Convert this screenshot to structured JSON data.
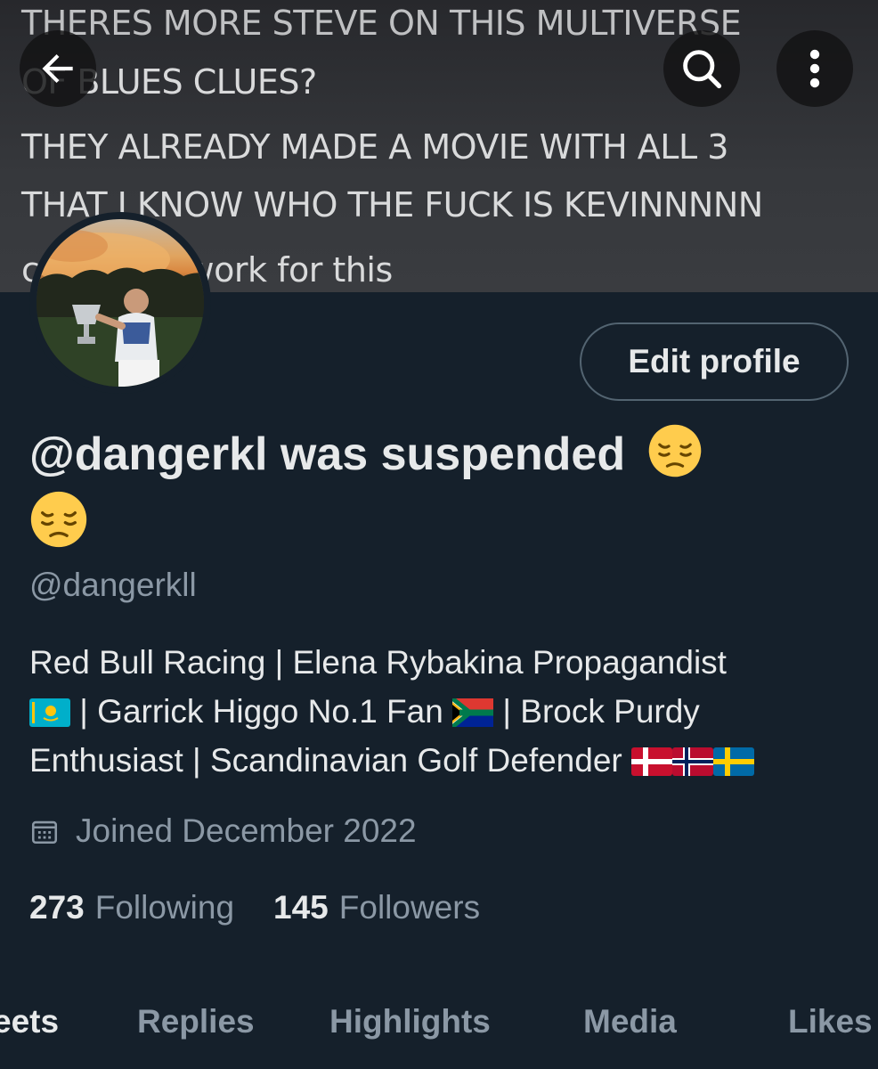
{
  "banner": {
    "lines": [
      "THERES MORE STEVE ON THIS MULTIVERSE",
      "OF BLUES CLUES?",
      "THEY ALREADY MADE A MOVIE WITH ALL 3",
      "THAT I KNOW WHO THE FUCK IS KEVINNNNN",
      "c… pping work for this"
    ]
  },
  "header": {
    "back_icon": "arrow-left-icon",
    "search_icon": "search-icon",
    "more_icon": "more-vertical-icon"
  },
  "profile": {
    "edit_label": "Edit profile",
    "display_name": "@dangerkl was suspended",
    "name_emoji": "pensive-face",
    "handle": "@dangerkll",
    "bio": {
      "part1": "Red Bull Racing | Elena Rybakina Propagandist",
      "part2": "| Garrick Higgo No.1 Fan",
      "part3": "| Brock Purdy Enthusiast | Scandinavian Golf Defender",
      "flags": [
        "kazakhstan",
        "south-africa",
        "denmark",
        "norway",
        "sweden"
      ]
    },
    "joined": "Joined December 2022",
    "following_count": "273",
    "following_label": "Following",
    "followers_count": "145",
    "followers_label": "Followers"
  },
  "tabs": [
    {
      "label": "eets",
      "active": true
    },
    {
      "label": "Replies",
      "active": false
    },
    {
      "label": "Highlights",
      "active": false
    },
    {
      "label": "Media",
      "active": false
    },
    {
      "label": "Likes",
      "active": false
    }
  ],
  "colors": {
    "background": "#15202b",
    "primary_text": "#e7e9ea",
    "secondary_text": "#8b98a5",
    "border": "#536471"
  }
}
